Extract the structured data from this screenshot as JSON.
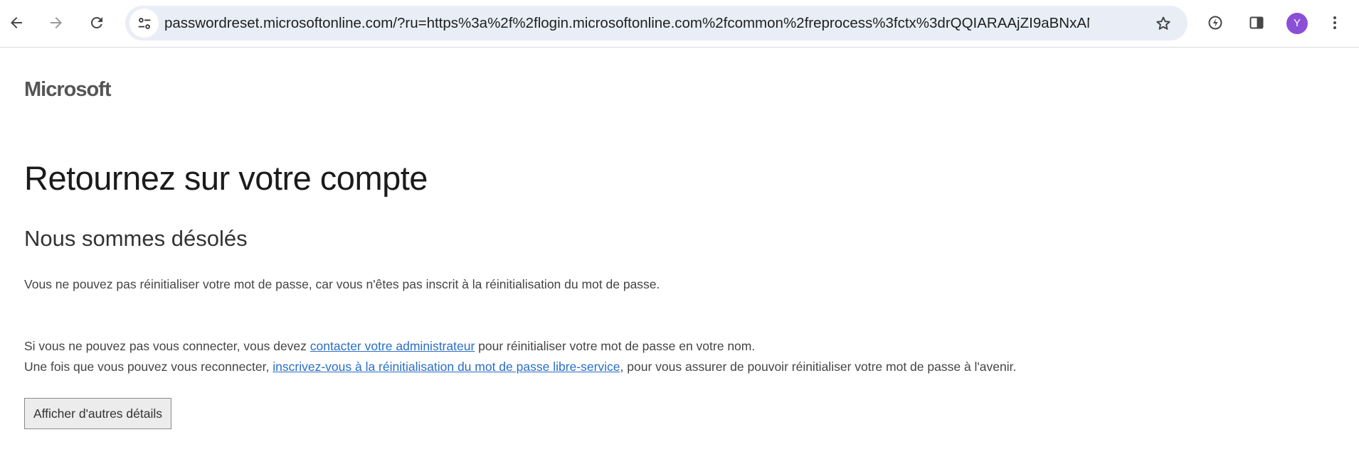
{
  "browser": {
    "url": "passwordreset.microsoftonline.com/?ru=https%3a%2f%2flogin.microsoftonline.com%2fcommon%2freprocess%3fctx%3drQQIARAAjZI9aBNxAMVzv...",
    "avatar_letter": "Y",
    "avatar_color": "#8a4fd6",
    "icons": {
      "back": "back-arrow-icon",
      "forward": "forward-arrow-icon",
      "reload": "reload-icon",
      "site_info": "tune-icon",
      "bookmark": "star-icon",
      "performance": "performance-icon",
      "side_panel": "side-panel-icon",
      "menu": "kebab-menu-icon"
    }
  },
  "page": {
    "brand": "Microsoft",
    "title": "Retournez sur votre compte",
    "subtitle": "Nous sommes désolés",
    "message": "Vous ne pouvez pas réinitialiser votre mot de passe, car vous n'êtes pas inscrit à la réinitialisation du mot de passe.",
    "line1": {
      "before": "Si vous ne pouvez pas vous connecter, vous devez ",
      "link": "contacter votre administrateur",
      "after": " pour réinitialiser votre mot de passe en votre nom."
    },
    "line2": {
      "before": "Une fois que vous pouvez vous reconnecter, ",
      "link": "inscrivez-vous à la réinitialisation du mot de passe libre-service",
      "after": ", pour vous assurer de pouvoir réinitialiser votre mot de passe à l'avenir."
    },
    "details_button": "Afficher d'autres détails",
    "link_color": "#2a6ec6"
  }
}
